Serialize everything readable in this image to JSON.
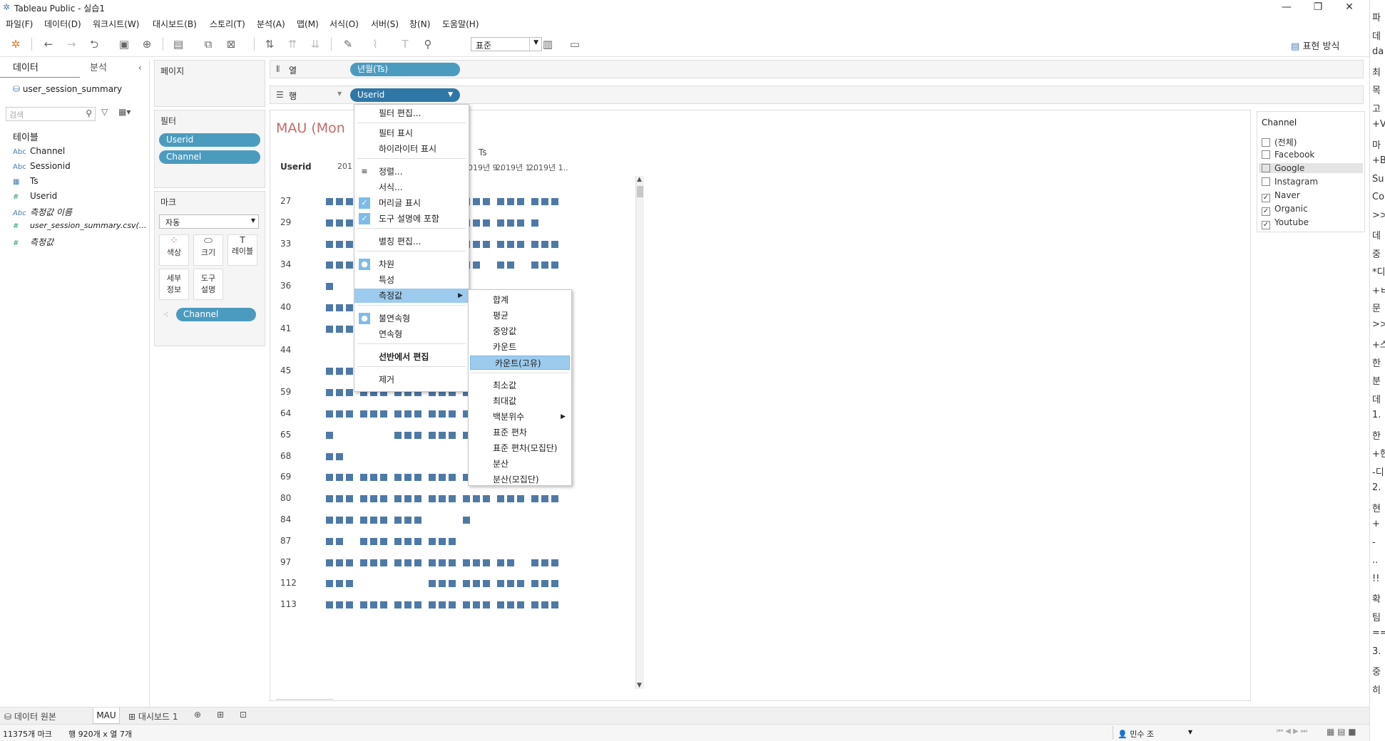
{
  "window": {
    "title": "Tableau Public - 실습1",
    "minimize": "—",
    "restore": "❐",
    "close": "✕"
  },
  "menu": [
    "파일(F)",
    "데이터(D)",
    "워크시트(W)",
    "대시보드(B)",
    "스토리(T)",
    "분석(A)",
    "맵(M)",
    "서식(O)",
    "서버(S)",
    "창(N)",
    "도움말(H)"
  ],
  "toolbar": {
    "fit_value": "표준",
    "show_me": "표현 방식"
  },
  "datapane": {
    "tab_data": "데이터",
    "tab_analysis": "분석",
    "source": "user_session_summary",
    "search_placeholder": "검색",
    "tables_label": "테이블",
    "fields": [
      {
        "type": "Abc",
        "name": "Channel"
      },
      {
        "type": "Abc",
        "name": "Sessionid"
      },
      {
        "type": "date",
        "name": "Ts"
      },
      {
        "type": "#",
        "name": "Userid"
      },
      {
        "type": "Abc",
        "name": "측정값 이름"
      },
      {
        "type": "#",
        "name": "user_session_summary.csv(..."
      },
      {
        "type": "#",
        "name": "측정값"
      }
    ]
  },
  "shelves": {
    "pages": "페이지",
    "filters_title": "필터",
    "filters": [
      "Userid",
      "Channel"
    ],
    "marks_title": "마크",
    "mark_type": "자동",
    "mark_buttons": [
      "색상",
      "크기",
      "레이블",
      "세부\n정보",
      "도구\n설명"
    ],
    "mark_pill": "Channel",
    "columns_label": "열",
    "columns_pill": "년월(Ts)",
    "rows_label": "행",
    "rows_pill": "Userid"
  },
  "viz": {
    "title": "MAU (Mon",
    "ts_header": "Ts",
    "row_header": "Userid",
    "col_headers": [
      "201",
      "2019년 8..",
      "2019년 9..",
      "2019년 1..",
      "2019년 1.."
    ],
    "rows": [
      "27",
      "29",
      "33",
      "34",
      "36",
      "40",
      "41",
      "44",
      "45",
      "59",
      "64",
      "65",
      "68",
      "69",
      "80",
      "84",
      "87",
      "97",
      "112",
      "113"
    ],
    "mark_color": "#4e79a7"
  },
  "legend": {
    "title": "Channel",
    "items": [
      {
        "label": "(전체)",
        "checked": false
      },
      {
        "label": "Facebook",
        "checked": false
      },
      {
        "label": "Google",
        "checked": false
      },
      {
        "label": "Instagram",
        "checked": false
      },
      {
        "label": "Naver",
        "checked": true
      },
      {
        "label": "Organic",
        "checked": true
      },
      {
        "label": "Youtube",
        "checked": true
      }
    ]
  },
  "context_menu": {
    "items": [
      "필터 편집...",
      "필터 표시",
      "하이라이터 표시",
      "정렬...",
      "서식...",
      "머리글 표시",
      "도구 설명에 포함",
      "별칭 편집...",
      "차원",
      "특성",
      "측정값",
      "불연속형",
      "연속형",
      "선반에서 편집",
      "제거"
    ]
  },
  "submenu": {
    "items": [
      "합계",
      "평균",
      "중앙값",
      "카운트",
      "카운트(고유)",
      "최소값",
      "최대값",
      "백분위수",
      "표준 편차",
      "표준 편차(모집단)",
      "분산",
      "분산(모집단)"
    ]
  },
  "tabs": {
    "datasource": "데이터 원본",
    "sheet": "MAU",
    "dashboard": "대시보드 1"
  },
  "status": {
    "marks": "11375개 마크",
    "dims": "행 920개 x 열 7개",
    "user": "민수 조"
  },
  "right_edge_text": [
    "파",
    "데",
    "da",
    "최",
    "목",
    "고",
    "+V",
    "마",
    "+B",
    "Su",
    "Co",
    ">>",
    "데",
    "중",
    "*디",
    "+ㅂ",
    "문",
    ">>",
    "+스",
    "한",
    "분",
    "데",
    "1.",
    "한",
    "+현",
    "-디",
    "2.",
    "현",
    "+",
    "-",
    "..",
    "!!",
    "확",
    "팀",
    "==",
    "3.",
    "중",
    "히"
  ]
}
